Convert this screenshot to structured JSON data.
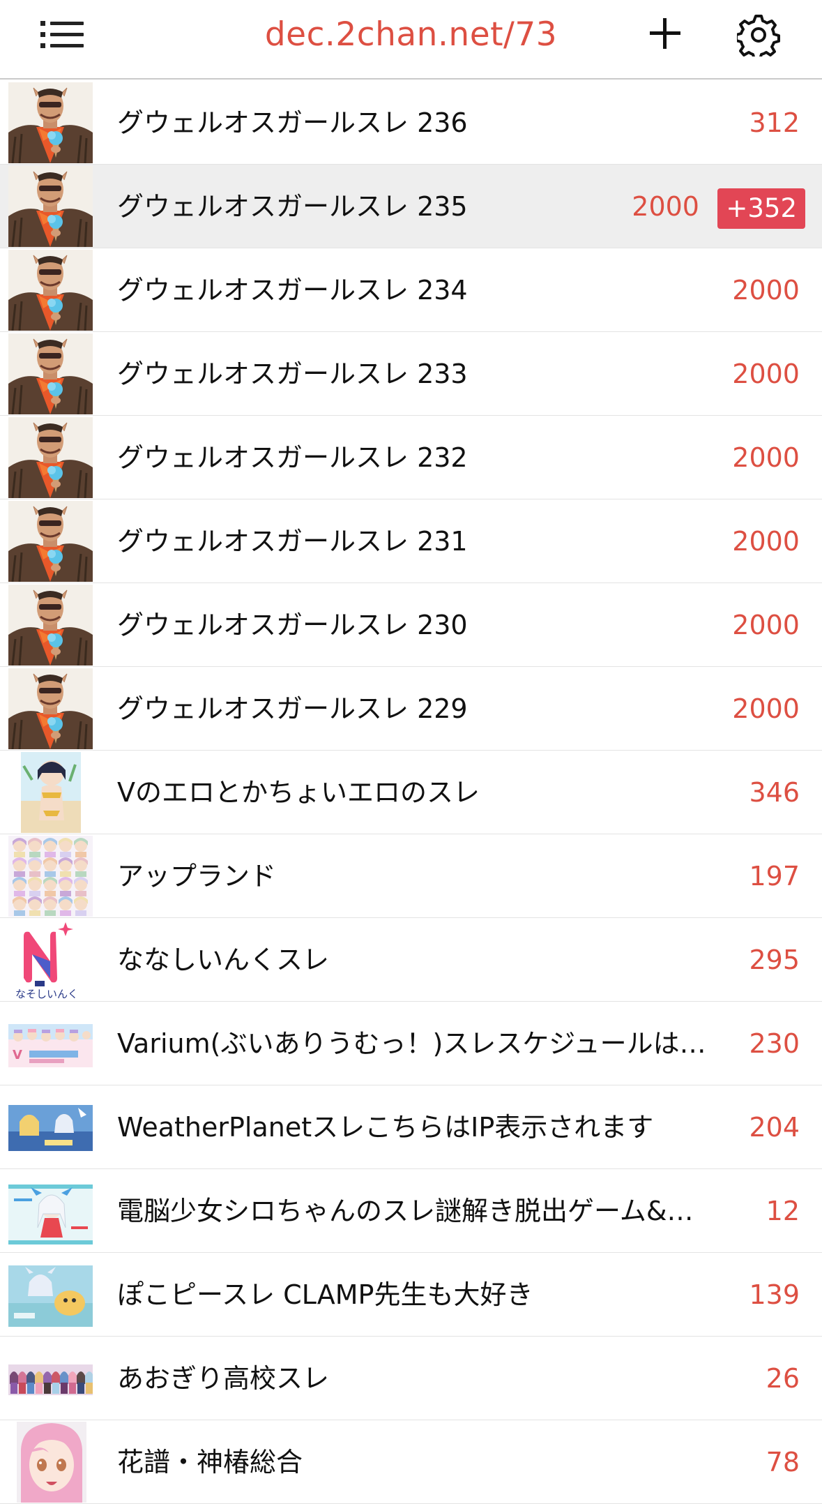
{
  "header": {
    "title": "dec.2chan.net/73",
    "menu_icon": "list-icon",
    "add_icon": "plus-icon",
    "settings_icon": "gear-icon"
  },
  "colors": {
    "accent": "#dd4f42",
    "badge": "#e24655",
    "highlight_row": "#eeeeee"
  },
  "threads": [
    {
      "title": "グウェルオスガールスレ 236",
      "count": "312",
      "thumb": "man-with-ice-cream"
    },
    {
      "title": "グウェルオスガールスレ 235",
      "count": "2000",
      "new_badge": "+352",
      "thumb": "man-with-ice-cream"
    },
    {
      "title": "グウェルオスガールスレ 234",
      "count": "2000",
      "thumb": "man-with-ice-cream"
    },
    {
      "title": "グウェルオスガールスレ 233",
      "count": "2000",
      "thumb": "man-with-ice-cream"
    },
    {
      "title": "グウェルオスガールスレ 232",
      "count": "2000",
      "thumb": "man-with-ice-cream"
    },
    {
      "title": "グウェルオスガールスレ 231",
      "count": "2000",
      "thumb": "man-with-ice-cream"
    },
    {
      "title": "グウェルオスガールスレ 230",
      "count": "2000",
      "thumb": "man-with-ice-cream"
    },
    {
      "title": "グウェルオスガールスレ 229",
      "count": "2000",
      "thumb": "man-with-ice-cream"
    },
    {
      "title": "Vのエロとかちょいエロのスレ",
      "count": "346",
      "thumb": "anime-girl-beach"
    },
    {
      "title": "アップランド",
      "count": "197",
      "thumb": "anime-group-collage"
    },
    {
      "title": "ななしいんくスレ",
      "count": "295",
      "thumb": "nanashi-inc-logo"
    },
    {
      "title": "Varium(ぶいありうむっ！)スレスケジュールはこち…",
      "count": "230",
      "thumb": "varium-banner"
    },
    {
      "title": "WeatherPlanetスレこちらはIP表示されます",
      "count": "204",
      "thumb": "weatherplanet-banner"
    },
    {
      "title": "電脳少女シロちゃんのスレ謎解き脱出ゲーム&コラボ…",
      "count": "12",
      "thumb": "siro-banner"
    },
    {
      "title": "ぽこピースレ CLAMP先生も大好き",
      "count": "139",
      "thumb": "pokopi-art"
    },
    {
      "title": "あおぎり高校スレ",
      "count": "26",
      "thumb": "aogiri-banner"
    },
    {
      "title": "花譜・神椿総合",
      "count": "78",
      "thumb": "pink-hair-girl"
    }
  ]
}
